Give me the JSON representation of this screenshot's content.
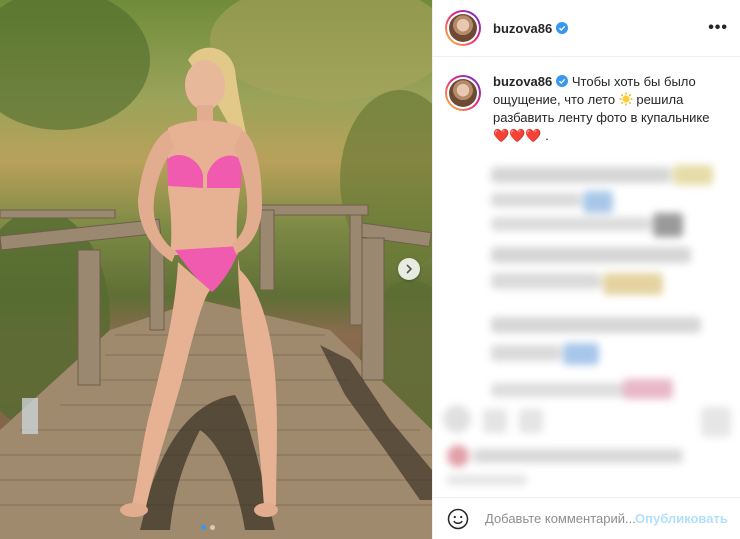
{
  "post": {
    "username": "buzova86",
    "caption_line1": "Чтобы хоть бы было",
    "caption_line2_a": "ощущение, что лето",
    "caption_line2_b": "решила",
    "caption_line3": "разбавить ленту фото в купальнике",
    "caption_hearts": "❤️❤️❤️",
    "caption_end": ".",
    "more_label": "•••"
  },
  "carousel": {
    "current": 1,
    "total": 2
  },
  "comment": {
    "placeholder": "Добавьте комментарий...",
    "publish_label": "Опубликовать"
  },
  "colors": {
    "verified": "#3897f0",
    "publish": "#b2dffc",
    "heart": "#e0245e",
    "avatar_ring": [
      "#f9ce34",
      "#ee2a7b",
      "#6228d7"
    ]
  },
  "icons": [
    "verified-badge-icon",
    "more-options-icon",
    "chevron-right-icon",
    "sun-emoji-icon",
    "emoji-smile-icon"
  ]
}
